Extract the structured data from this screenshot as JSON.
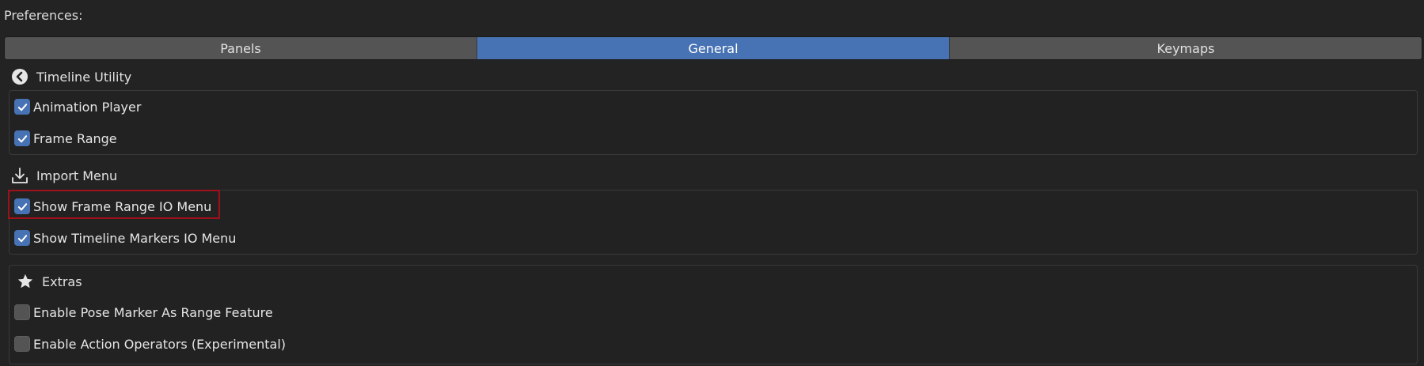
{
  "window": {
    "title": "Preferences:"
  },
  "tabs": [
    {
      "label": "Panels",
      "active": false
    },
    {
      "label": "General",
      "active": true
    },
    {
      "label": "Keymaps",
      "active": false
    }
  ],
  "sections": {
    "timeline_utility": {
      "title": "Timeline Utility",
      "icon": "back-circle-icon",
      "options": [
        {
          "label": "Animation Player",
          "checked": true
        },
        {
          "label": "Frame Range",
          "checked": true
        }
      ]
    },
    "import_menu": {
      "title": "Import Menu",
      "icon": "import-icon",
      "options": [
        {
          "label": "Show Frame Range IO Menu",
          "checked": true,
          "highlighted": true
        },
        {
          "label": "Show Timeline Markers IO Menu",
          "checked": true
        }
      ]
    },
    "extras": {
      "title": "Extras",
      "icon": "star-icon",
      "options": [
        {
          "label": "Enable Pose Marker As Range Feature",
          "checked": false
        },
        {
          "label": "Enable Action Operators (Experimental)",
          "checked": false
        }
      ]
    }
  },
  "colors": {
    "background": "#232323",
    "accent": "#4772b3",
    "tab": "#545454",
    "highlight_border": "#a0101a"
  }
}
